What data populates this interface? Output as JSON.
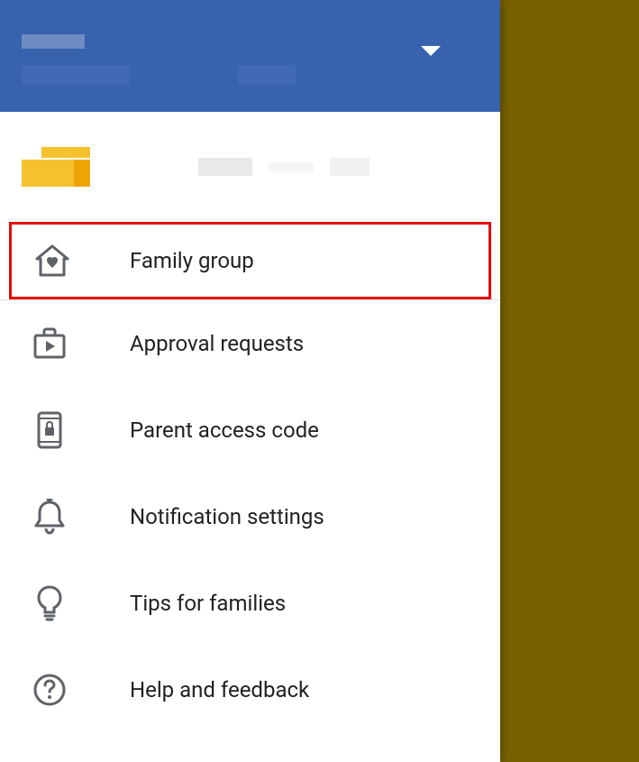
{
  "menu": {
    "items": [
      {
        "label": "Family group",
        "icon": "house-heart",
        "highlighted": true
      },
      {
        "label": "Approval requests",
        "icon": "briefcase-play",
        "highlighted": false
      },
      {
        "label": "Parent access code",
        "icon": "phone-lock",
        "highlighted": false
      },
      {
        "label": "Notification settings",
        "icon": "bell",
        "highlighted": false
      },
      {
        "label": "Tips for families",
        "icon": "lightbulb",
        "highlighted": false
      },
      {
        "label": "Help and feedback",
        "icon": "help-circle",
        "highlighted": false
      }
    ]
  }
}
